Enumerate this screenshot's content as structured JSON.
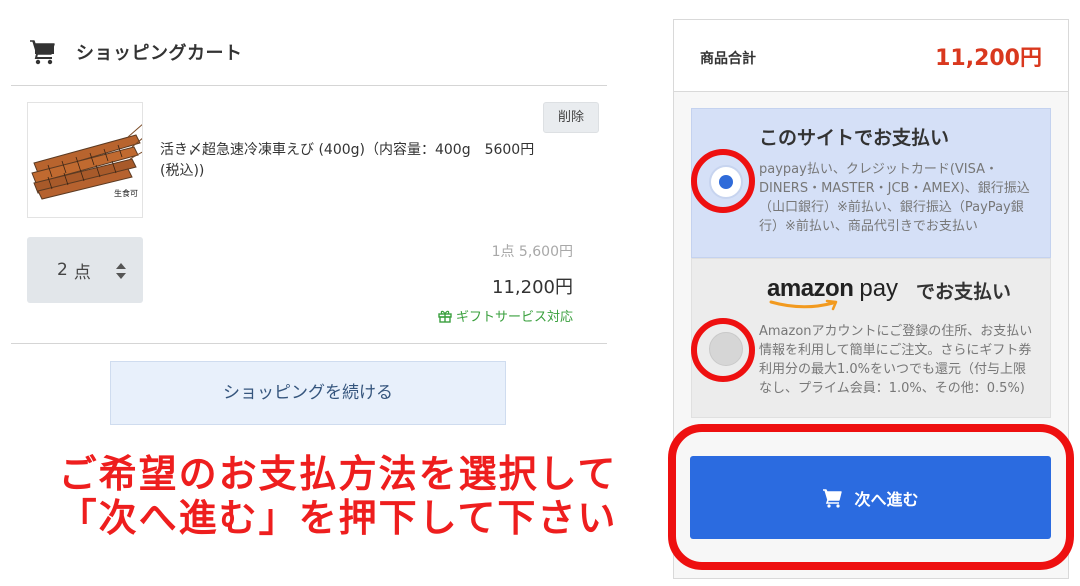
{
  "cart": {
    "title": "ショッピングカート",
    "item": {
      "name": "活き〆超急速冷凍車えび (400g)（内容量：400g　5600円(税込))",
      "thumb_caption": "生食可",
      "delete_label": "削除",
      "quantity": "2",
      "quantity_unit": "点",
      "unit_price": "1点 5,600円",
      "line_total": "11,200円",
      "gift_label": "ギフトサービス対応"
    },
    "continue_label": "ショッピングを続ける"
  },
  "instruction": {
    "line1": "ご希望のお支払方法を選択して",
    "line2": "「次へ進む」を押下して下さい"
  },
  "summary": {
    "subtotal_label": "商品合計",
    "subtotal_value": "11,200円",
    "payment_options": [
      {
        "id": "site",
        "title": "このサイトでお支払い",
        "description": "paypay払い、クレジットカード(VISA・DINERS・MASTER・JCB・AMEX)、銀行振込（山口銀行）※前払い、銀行振込（PayPay銀行）※前払い、商品代引きでお支払い",
        "selected": true
      },
      {
        "id": "amazon",
        "logo_brand": "amazon",
        "logo_pay": "pay",
        "title_suffix": "でお支払い",
        "description": "Amazonアカウントにご登録の住所、お支払い情報を利用して簡単にご注文。さらにギフト券利用分の最大1.0%をいつでも還元（付与上限なし、プライム会員：1.0%、その他：0.5%)",
        "selected": false
      }
    ],
    "next_label": "次へ進む"
  },
  "colors": {
    "accent_blue": "#2b6be0",
    "price_red": "#d9381e",
    "annotation_red": "#ee1010",
    "gift_green": "#3aa03e"
  },
  "icons": [
    "cart-icon",
    "sort-arrows-icon",
    "gift-icon",
    "amazon-smile-logo"
  ]
}
